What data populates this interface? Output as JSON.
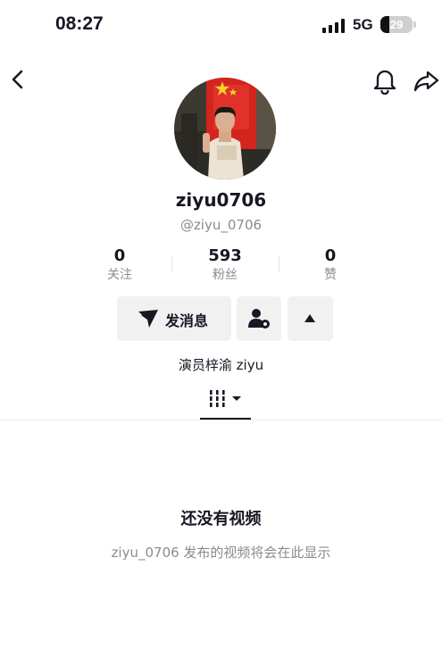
{
  "status_bar": {
    "time": "08:27",
    "network": "5G",
    "battery_percent": "29",
    "battery_level": 0.29
  },
  "nav": {
    "back_icon": "chevron-left-icon",
    "notification_icon": "bell-icon",
    "share_icon": "share-arrow-icon"
  },
  "profile": {
    "username": "ziyu0706",
    "handle": "@ziyu_0706",
    "bio": "演员梓渝 ziyu",
    "avatar_icon": "profile-photo"
  },
  "stats": [
    {
      "value": "0",
      "label": "关注"
    },
    {
      "value": "593",
      "label": "粉丝"
    },
    {
      "value": "0",
      "label": "赞"
    }
  ],
  "actions": {
    "message_label": "发消息",
    "message_icon": "send-icon",
    "add_friend_icon": "user-settings-icon",
    "more_icon": "caret-up-icon"
  },
  "tab": {
    "icon": "grid-columns-icon"
  },
  "empty_state": {
    "title": "还没有视频",
    "subtitle": "ziyu_0706 发布的视频将会在此显示"
  },
  "colors": {
    "text_primary": "#161823",
    "text_secondary": "#8a8b91",
    "button_bg": "#f1f1f2",
    "divider": "#e3e3e4"
  }
}
